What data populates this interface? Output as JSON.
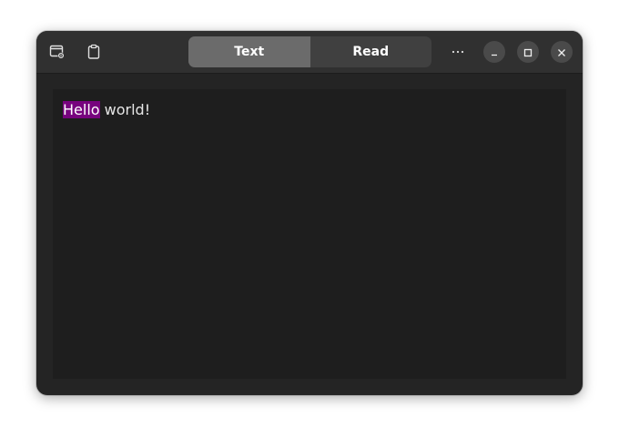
{
  "toolbar": {
    "left_icons": [
      "window-settings-icon",
      "clipboard-icon"
    ],
    "menu_icon": "more-horizontal-icon"
  },
  "view_switcher": {
    "tabs": [
      {
        "label": "Text",
        "active": true
      },
      {
        "label": "Read",
        "active": false
      }
    ]
  },
  "window_controls": [
    "minimize-icon",
    "maximize-icon",
    "close-icon"
  ],
  "editor": {
    "highlighted_word": "Hello",
    "rest_text": " world!",
    "highlight_color": "#77037e"
  },
  "colors": {
    "window_bg": "#242424",
    "headerbar_bg": "#303030",
    "content_bg": "#1e1e1e",
    "active_tab": "#6b6b6b",
    "inactive_tab": "#404040"
  }
}
